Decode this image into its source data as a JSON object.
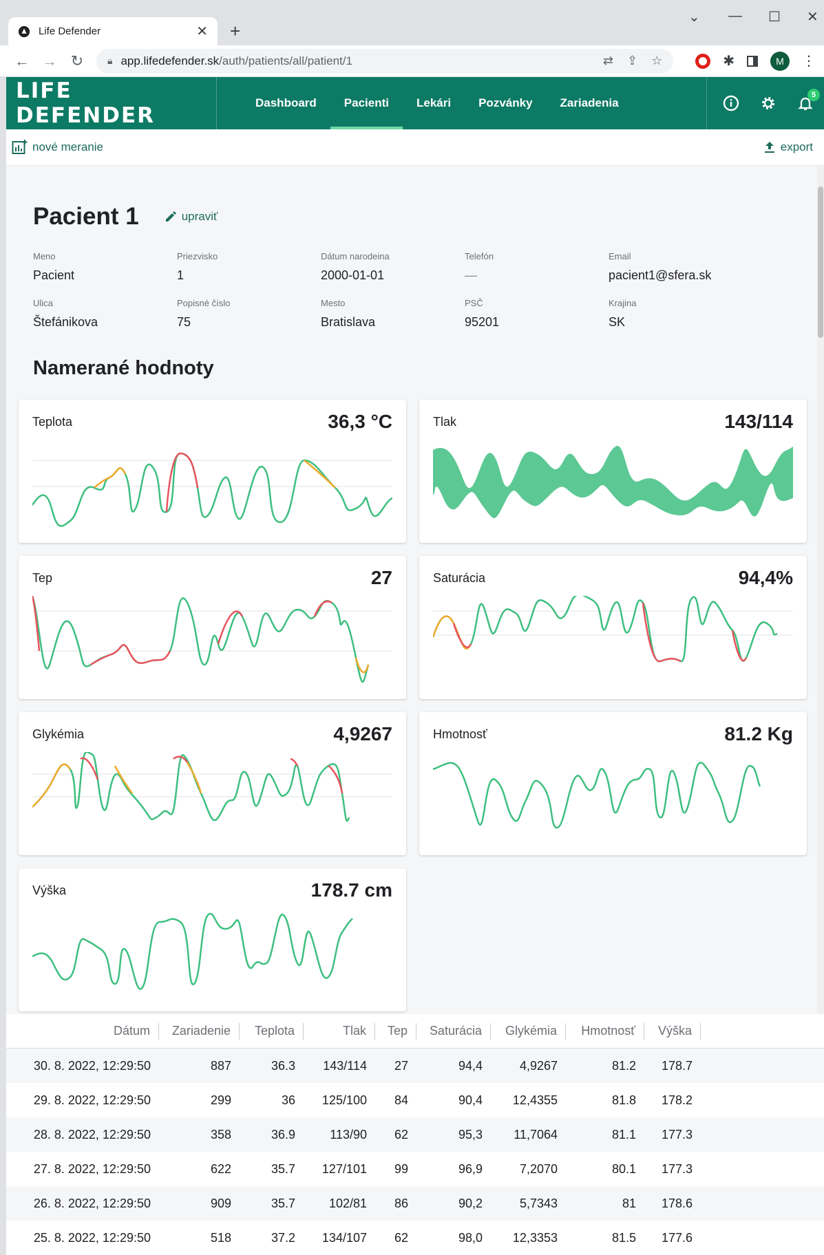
{
  "browser": {
    "tab_title": "Life Defender",
    "url_domain": "app.lifedefender.sk",
    "url_path": "/auth/patients/all/patient/1",
    "profile_initial": "M"
  },
  "app": {
    "brand": "LIFE DEFENDER",
    "nav": [
      "Dashboard",
      "Pacienti",
      "Lekári",
      "Pozvánky",
      "Zariadenia"
    ],
    "active_nav": "Pacienti",
    "notification_count": "5",
    "accent_color": "#0d7a65"
  },
  "actions": {
    "new_measurement": "nové meranie",
    "export": "export"
  },
  "patient": {
    "name": "Pacient 1",
    "edit_label": "upraviť",
    "fields": [
      {
        "label": "Meno",
        "value": "Pacient"
      },
      {
        "label": "Priezvisko",
        "value": "1"
      },
      {
        "label": "Dátum narodeina",
        "value": "2000-01-01"
      },
      {
        "label": "Telefón",
        "value": "—"
      },
      {
        "label": "Email",
        "value": "pacient1@sfera.sk"
      },
      {
        "label": "Ulica",
        "value": "Štefánikova"
      },
      {
        "label": "Popisné číslo",
        "value": "75"
      },
      {
        "label": "Mesto",
        "value": "Bratislava"
      },
      {
        "label": "PSČ",
        "value": "95201"
      },
      {
        "label": "Krajina",
        "value": "SK"
      }
    ]
  },
  "measurements_title": "Namerané hodnoty",
  "cards": [
    {
      "title": "Teplota",
      "value": "36,3 °C"
    },
    {
      "title": "Tlak",
      "value": "143/114"
    },
    {
      "title": "Tep",
      "value": "27"
    },
    {
      "title": "Saturácia",
      "value": "94,4%"
    },
    {
      "title": "Glykémia",
      "value": "4,9267"
    },
    {
      "title": "Hmotnosť",
      "value": "81.2 Kg"
    },
    {
      "title": "Výška",
      "value": "178.7 cm"
    }
  ],
  "table": {
    "columns": [
      "Dátum",
      "Zariadenie",
      "Teplota",
      "Tlak",
      "Tep",
      "Saturácia",
      "Glykémia",
      "Hmotnosť",
      "Výška"
    ],
    "rows": [
      [
        "30. 8. 2022, 12:29:50",
        "887",
        "36.3",
        "143/114",
        "27",
        "94,4",
        "4,9267",
        "81.2",
        "178.7"
      ],
      [
        "29. 8. 2022, 12:29:50",
        "299",
        "36",
        "125/100",
        "84",
        "90,4",
        "12,4355",
        "81.8",
        "178.2"
      ],
      [
        "28. 8. 2022, 12:29:50",
        "358",
        "36.9",
        "113/90",
        "62",
        "95,3",
        "11,7064",
        "81.1",
        "177.3"
      ],
      [
        "27. 8. 2022, 12:29:50",
        "622",
        "35.7",
        "127/101",
        "99",
        "96,9",
        "7,2070",
        "80.1",
        "177.3"
      ],
      [
        "26. 8. 2022, 12:29:50",
        "909",
        "35.7",
        "102/81",
        "86",
        "90,2",
        "5,7343",
        "81",
        "178.6"
      ],
      [
        "25. 8. 2022, 12:29:50",
        "518",
        "37.2",
        "134/107",
        "62",
        "98,0",
        "12,3353",
        "81.5",
        "177.6"
      ]
    ]
  },
  "colors": {
    "green": "#3dbf7f",
    "orange": "#f0a82a",
    "red": "#e8545e",
    "band": "#5cc894"
  }
}
